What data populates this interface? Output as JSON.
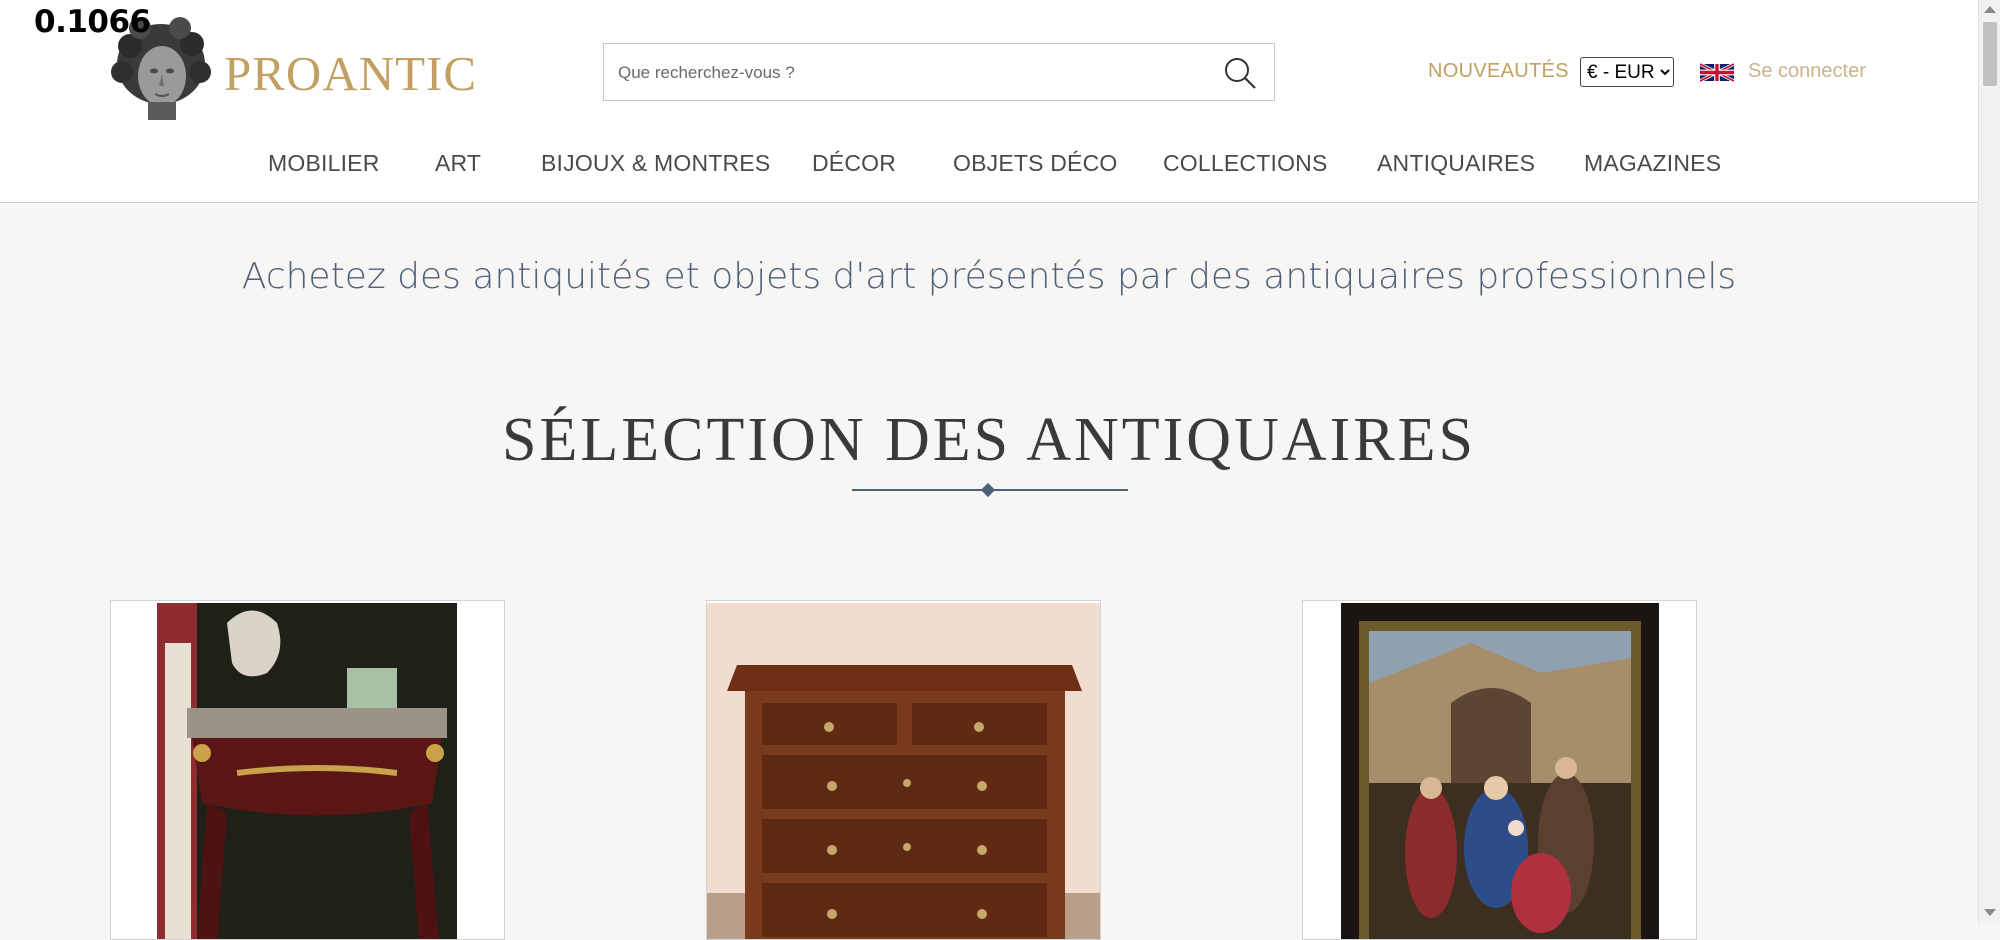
{
  "debug_value": "0.1066",
  "header": {
    "brand": "PROANTIC",
    "search": {
      "placeholder": "Que recherchez-vous ?"
    },
    "new_link": "NOUVEAUTÉS",
    "currency": {
      "selected": "€ - EUR"
    },
    "language_flag": "uk-flag-icon",
    "login_link": "Se connecter"
  },
  "nav": {
    "items": [
      "MOBILIER",
      "ART",
      "BIJOUX & MONTRES",
      "DÉCOR",
      "OBJETS DÉCO",
      "COLLECTIONS",
      "ANTIQUAIRES",
      "MAGAZINES"
    ]
  },
  "main": {
    "tagline": "Achetez des antiquités et objets d'art présentés par des antiquaires professionnels",
    "section_title": "SÉLECTION DES ANTIQUAIRES",
    "cards": [
      {
        "icon": "louis-xv-console-table-photo"
      },
      {
        "icon": "walnut-chest-of-drawers-photo"
      },
      {
        "icon": "adoration-of-the-magi-painting-photo"
      }
    ]
  },
  "colors": {
    "brand_gold": "#c1a062",
    "tagline_blue": "#4d6178",
    "background": "#f7f6f4"
  }
}
